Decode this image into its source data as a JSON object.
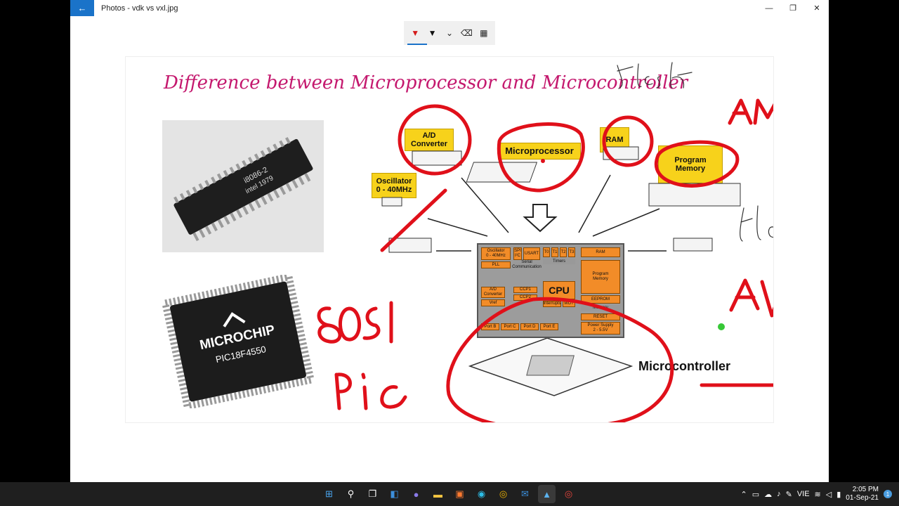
{
  "titlebar": {
    "back_icon": "arrow-left-icon",
    "title": "Photos - vdk vs vxl.jpg",
    "minimize": "—",
    "maximize": "❐",
    "close": "✕"
  },
  "pen_tools": [
    {
      "name": "red-pen",
      "glyph": "▼",
      "color": "#d41a1a"
    },
    {
      "name": "black-pen",
      "glyph": "▼",
      "color": "#111111"
    },
    {
      "name": "pencil",
      "glyph": "⌄",
      "color": "#444444"
    },
    {
      "name": "eraser",
      "glyph": "⌫",
      "color": "#444444"
    },
    {
      "name": "ruler",
      "glyph": "▦",
      "color": "#444444"
    }
  ],
  "slide": {
    "title": "Difference between Microprocessor and Microcontroller",
    "chip_dip_text": "i8086-2\nintel 1979",
    "chip_qfp_brand": "MICROCHIP",
    "chip_qfp_model": "PIC18F4550",
    "labels": {
      "ad": "A/D\nConverter",
      "microprocessor": "Microprocessor",
      "ram": "RAM",
      "program_memory": "Program\nMemory",
      "oscillator": "Oscillator\n0 - 40MHz"
    },
    "block": {
      "oscillator": "Oscillator\n0 - 40MHz",
      "pll": "PLL",
      "spi": "SPI\nI²C",
      "usart": "USART",
      "serial": "Serial\nCommunication",
      "t0": "T0",
      "t1": "T1",
      "t2": "T2",
      "t3": "T3",
      "timers": "Timers",
      "ram": "RAM",
      "program_memory": "Program\nMemory",
      "ad_converter": "A/D\nConverter",
      "vref": "Vref",
      "ccp1": "CCP1",
      "ccp2": "CCP2",
      "cpu": "CPU",
      "interrupts": "Interrupts",
      "wdt": "WDT",
      "eeprom": "EEPROM",
      "memory": "Memory",
      "reset": "RESET",
      "port_b": "Port B",
      "port_c": "Port C",
      "port_d": "Port D",
      "port_e": "Port E",
      "power": "Power Supply\n2 - 5.5V"
    },
    "microcontroller_label": "Microcontroller"
  },
  "taskbar": {
    "icons": [
      "windows-start-icon",
      "search-icon",
      "task-view-icon",
      "widgets-icon",
      "chat-icon",
      "file-explorer-icon",
      "store-icon",
      "edge-icon",
      "chrome-icon",
      "mail-icon",
      "photos-icon",
      "chrome-alt-icon"
    ],
    "tray_language": "VIE",
    "time": "2:05 PM",
    "date": "01-Sep-21",
    "notification_count": "1"
  }
}
